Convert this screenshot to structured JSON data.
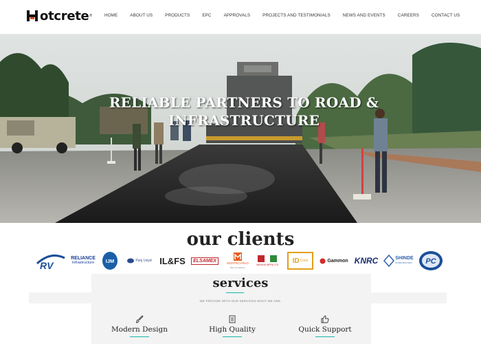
{
  "header": {
    "logo_text": "otcrete",
    "logo_mark": "H",
    "logo_reg": "®",
    "nav": [
      "HOME",
      "ABOUT US",
      "PRODUCTS",
      "EPC",
      "APPROVALS",
      "PROJECTS AND TESTIMONIALS",
      "NEWS AND EVENTS",
      "CAREERS",
      "CONTACT US"
    ]
  },
  "hero": {
    "title_line1": "RELIABLE PARTNERS TO ROAD &",
    "title_line2": "INFRASTRUCTURE"
  },
  "clients": {
    "title": "our clients",
    "logos": [
      {
        "text": "RV",
        "color": "#1d4f9a"
      },
      {
        "text": "RELIANCE",
        "sub": "Infrastructure",
        "color": "#1b3f94"
      },
      {
        "text": "IJM",
        "color": "#1a5fa8"
      },
      {
        "text": "Punj Lloyd",
        "color": "#2a4c8c"
      },
      {
        "text": "IL&FS",
        "color": "#222222"
      },
      {
        "text": "ELSAMEX",
        "color": "#c0282d"
      },
      {
        "text": "MONTECARLO",
        "sub": "Born to Achieve",
        "color": "#e55a1f"
      },
      {
        "text": "VARAHA INFRA LTD",
        "color": "#c0282d"
      },
      {
        "text": "ID",
        "sub": "Cons",
        "color": "#e0a019"
      },
      {
        "text": "Gammon",
        "color": "#1d1d1d"
      },
      {
        "text": "KNRC",
        "color": "#1a2f72"
      },
      {
        "text": "SHINDE",
        "sub": "CONSTRUCTION",
        "color": "#2f5fae"
      },
      {
        "text": "PC",
        "color": "#1a4f9a"
      }
    ]
  },
  "services": {
    "title": "services",
    "subtitle": "WE PROVIDE WITH OUR SERVICES WHAT WE ARE.",
    "features": [
      {
        "label": "Modern Design",
        "icon": "paint-brush-icon"
      },
      {
        "label": "High Quality",
        "icon": "document-icon"
      },
      {
        "label": "Quick Support",
        "icon": "thumbs-up-icon"
      }
    ],
    "accent_color": "#18b7a5"
  }
}
